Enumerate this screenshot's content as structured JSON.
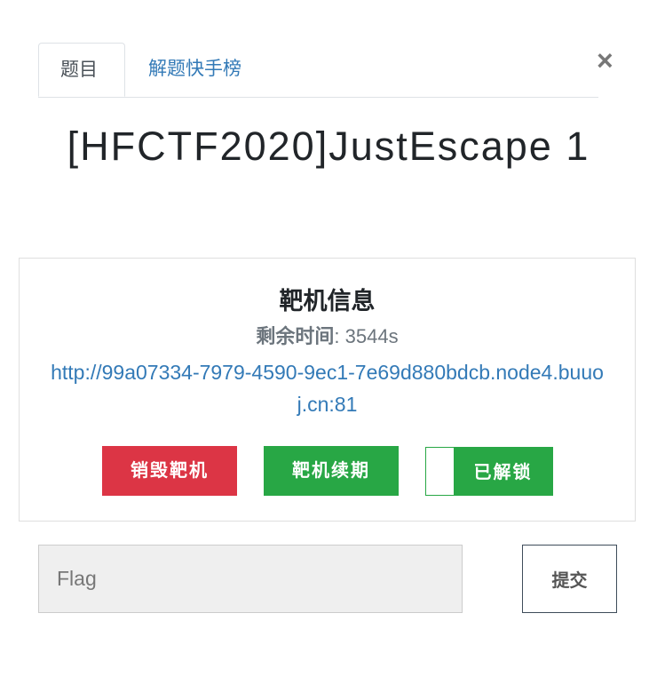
{
  "tabs": [
    {
      "label": "题目",
      "active": true
    },
    {
      "label": "解题快手榜",
      "active": false
    }
  ],
  "close_label": "×",
  "challenge_title": "[HFCTF2020]JustEscape 1",
  "target": {
    "heading": "靶机信息",
    "time_label": "剩余时间",
    "time_value": ": 3544s",
    "url": "http://99a07334-7979-4590-9ec1-7e69d880bdcb.node4.buuoj.cn:81",
    "destroy_label": "销毁靶机",
    "renew_label": "靶机续期",
    "unlock_label": "已解锁"
  },
  "flag": {
    "placeholder": "Flag",
    "value": ""
  },
  "submit_label": "提交",
  "colors": {
    "danger": "#dc3545",
    "success": "#28a745",
    "link": "#337ab7"
  }
}
